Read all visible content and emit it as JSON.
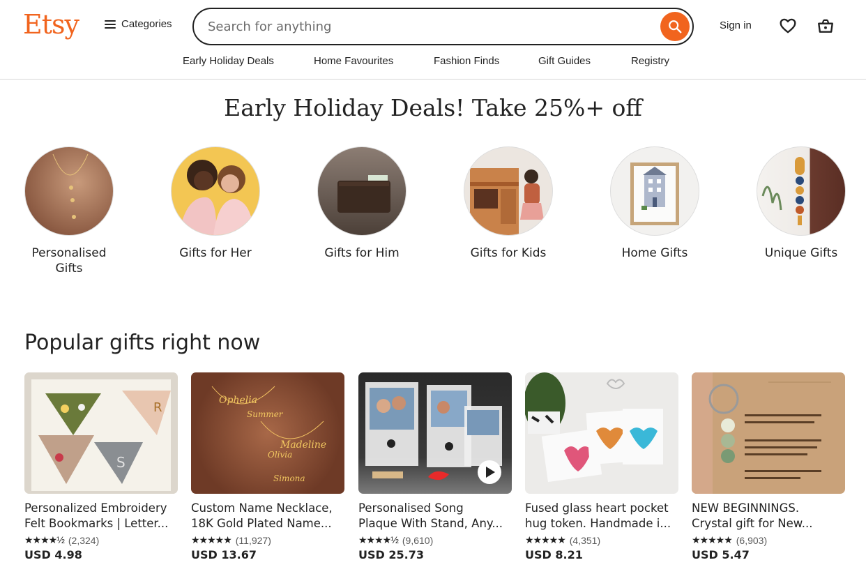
{
  "header": {
    "logo": "Etsy",
    "categories_label": "Categories",
    "search_placeholder": "Search for anything",
    "signin_label": "Sign in",
    "nav": [
      "Early Holiday Deals",
      "Home Favourites",
      "Fashion Finds",
      "Gift Guides",
      "Registry"
    ]
  },
  "banner": {
    "title": "Early Holiday Deals! Take 25%+ off"
  },
  "categories": [
    {
      "label": "Personalised Gifts"
    },
    {
      "label": "Gifts for Her"
    },
    {
      "label": "Gifts for Him"
    },
    {
      "label": "Gifts for Kids"
    },
    {
      "label": "Home Gifts"
    },
    {
      "label": "Unique Gifts"
    }
  ],
  "popular": {
    "title": "Popular gifts right now",
    "items": [
      {
        "line1": "Personalized Embroidery",
        "line2": "Felt Bookmarks | Letter...",
        "stars": "★★★★½",
        "reviews": "(2,324)",
        "price": "USD 4.98"
      },
      {
        "line1": "Custom Name Necklace,",
        "line2": "18K Gold Plated Name...",
        "stars": "★★★★★",
        "reviews": "(11,927)",
        "price": "USD 13.67"
      },
      {
        "line1": "Personalised Song",
        "line2": "Plaque With Stand, Any...",
        "stars": "★★★★½",
        "reviews": "(9,610)",
        "price": "USD 25.73"
      },
      {
        "line1": "Fused glass heart pocket",
        "line2": "hug token. Handmade i...",
        "stars": "★★★★★",
        "reviews": "(4,351)",
        "price": "USD 8.21"
      },
      {
        "line1": "NEW BEGINNINGS.",
        "line2": "Crystal gift for New...",
        "stars": "★★★★★",
        "reviews": "(6,903)",
        "price": "USD 5.47"
      }
    ]
  },
  "colors": {
    "brand": "#f1641e",
    "text": "#222222"
  }
}
